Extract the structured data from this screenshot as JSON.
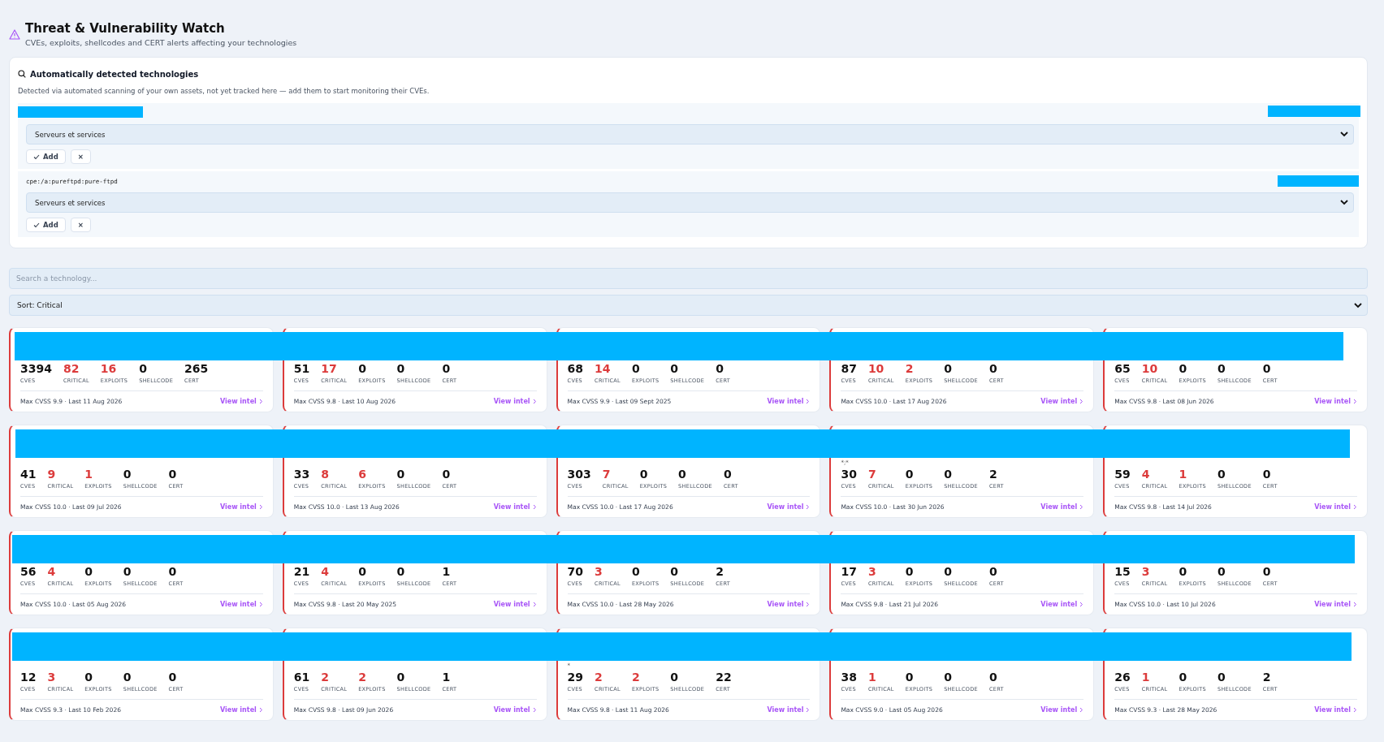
{
  "header": {
    "title": "Threat & Vulnerability Watch",
    "subtitle": "CVEs, exploits, shellcodes and CERT alerts affecting your technologies"
  },
  "detected": {
    "title": "Automatically detected technologies",
    "description": "Detected via automated scanning of your own assets, not yet tracked here — add them to start monitoring their CVEs.",
    "items": [
      {
        "category": "Serveurs et services",
        "add": "Add",
        "dismiss": "×"
      },
      {
        "cpe": "cpe:/a:pureftpd:pure-ftpd",
        "category": "Serveurs et services",
        "add": "Add",
        "dismiss": "×"
      }
    ]
  },
  "search": {
    "placeholder": "Search a technology..."
  },
  "sort": {
    "value": "Sort: Critical"
  },
  "cards": [
    {
      "stats": [
        {
          "value": "3394",
          "label": "CVES",
          "highlight": false
        },
        {
          "value": "82",
          "label": "CRITICAL",
          "highlight": true
        },
        {
          "value": "16",
          "label": "EXPLOITS",
          "highlight": true
        },
        {
          "value": "0",
          "label": "SHELLCODE",
          "highlight": false
        },
        {
          "value": "265",
          "label": "CERT",
          "highlight": false
        }
      ],
      "footer": "Max CVSS 9.9 · Last 11 Aug 2026",
      "link": "View intel"
    },
    {
      "stats": [
        {
          "value": "51",
          "label": "CVES",
          "highlight": false
        },
        {
          "value": "17",
          "label": "CRITICAL",
          "highlight": true
        },
        {
          "value": "0",
          "label": "EXPLOITS",
          "highlight": false
        },
        {
          "value": "0",
          "label": "SHELLCODE",
          "highlight": false
        },
        {
          "value": "0",
          "label": "CERT",
          "highlight": false
        }
      ],
      "footer": "Max CVSS 9.8 · Last 10 Aug 2026",
      "link": "View intel"
    },
    {
      "stats": [
        {
          "value": "68",
          "label": "CVES",
          "highlight": false
        },
        {
          "value": "14",
          "label": "CRITICAL",
          "highlight": true
        },
        {
          "value": "0",
          "label": "EXPLOITS",
          "highlight": false
        },
        {
          "value": "0",
          "label": "SHELLCODE",
          "highlight": false
        },
        {
          "value": "0",
          "label": "CERT",
          "highlight": false
        }
      ],
      "footer": "Max CVSS 9.9 · Last 09 Sept 2025",
      "link": "View intel"
    },
    {
      "stats": [
        {
          "value": "87",
          "label": "CVES",
          "highlight": false
        },
        {
          "value": "10",
          "label": "CRITICAL",
          "highlight": true
        },
        {
          "value": "2",
          "label": "EXPLOITS",
          "highlight": true
        },
        {
          "value": "0",
          "label": "SHELLCODE",
          "highlight": false
        },
        {
          "value": "0",
          "label": "CERT",
          "highlight": false
        }
      ],
      "footer": "Max CVSS 10.0 · Last 17 Aug 2026",
      "link": "View intel"
    },
    {
      "stats": [
        {
          "value": "65",
          "label": "CVES",
          "highlight": false
        },
        {
          "value": "10",
          "label": "CRITICAL",
          "highlight": true
        },
        {
          "value": "0",
          "label": "EXPLOITS",
          "highlight": false
        },
        {
          "value": "0",
          "label": "SHELLCODE",
          "highlight": false
        },
        {
          "value": "0",
          "label": "CERT",
          "highlight": false
        }
      ],
      "footer": "Max CVSS 9.8 · Last 08 Jun 2026",
      "link": "View intel"
    },
    {
      "stats": [
        {
          "value": "41",
          "label": "CVES",
          "highlight": false
        },
        {
          "value": "9",
          "label": "CRITICAL",
          "highlight": true
        },
        {
          "value": "1",
          "label": "EXPLOITS",
          "highlight": true
        },
        {
          "value": "0",
          "label": "SHELLCODE",
          "highlight": false
        },
        {
          "value": "0",
          "label": "CERT",
          "highlight": false
        }
      ],
      "footer": "Max CVSS 10.0 · Last 09 Jul 2026",
      "link": "View intel"
    },
    {
      "stats": [
        {
          "value": "33",
          "label": "CVES",
          "highlight": false
        },
        {
          "value": "8",
          "label": "CRITICAL",
          "highlight": true
        },
        {
          "value": "6",
          "label": "EXPLOITS",
          "highlight": true
        },
        {
          "value": "0",
          "label": "SHELLCODE",
          "highlight": false
        },
        {
          "value": "0",
          "label": "CERT",
          "highlight": false
        }
      ],
      "footer": "Max CVSS 10.0 · Last 13 Aug 2026",
      "link": "View intel"
    },
    {
      "stats": [
        {
          "value": "303",
          "label": "CVES",
          "highlight": false
        },
        {
          "value": "7",
          "label": "CRITICAL",
          "highlight": true
        },
        {
          "value": "0",
          "label": "EXPLOITS",
          "highlight": false
        },
        {
          "value": "0",
          "label": "SHELLCODE",
          "highlight": false
        },
        {
          "value": "0",
          "label": "CERT",
          "highlight": false
        }
      ],
      "footer": "Max CVSS 10.0 · Last 17 Aug 2026",
      "link": "View intel"
    },
    {
      "note": "*;*",
      "stats": [
        {
          "value": "30",
          "label": "CVES",
          "highlight": false
        },
        {
          "value": "7",
          "label": "CRITICAL",
          "highlight": true
        },
        {
          "value": "0",
          "label": "EXPLOITS",
          "highlight": false
        },
        {
          "value": "0",
          "label": "SHELLCODE",
          "highlight": false
        },
        {
          "value": "2",
          "label": "CERT",
          "highlight": false
        }
      ],
      "footer": "Max CVSS 10.0 · Last 30 Jun 2026",
      "link": "View intel"
    },
    {
      "stats": [
        {
          "value": "59",
          "label": "CVES",
          "highlight": false
        },
        {
          "value": "4",
          "label": "CRITICAL",
          "highlight": true
        },
        {
          "value": "1",
          "label": "EXPLOITS",
          "highlight": true
        },
        {
          "value": "0",
          "label": "SHELLCODE",
          "highlight": false
        },
        {
          "value": "0",
          "label": "CERT",
          "highlight": false
        }
      ],
      "footer": "Max CVSS 9.8 · Last 14 Jul 2026",
      "link": "View intel"
    },
    {
      "stats": [
        {
          "value": "56",
          "label": "CVES",
          "highlight": false
        },
        {
          "value": "4",
          "label": "CRITICAL",
          "highlight": true
        },
        {
          "value": "0",
          "label": "EXPLOITS",
          "highlight": false
        },
        {
          "value": "0",
          "label": "SHELLCODE",
          "highlight": false
        },
        {
          "value": "0",
          "label": "CERT",
          "highlight": false
        }
      ],
      "footer": "Max CVSS 10.0 · Last 05 Aug 2026",
      "link": "View intel"
    },
    {
      "stats": [
        {
          "value": "21",
          "label": "CVES",
          "highlight": false
        },
        {
          "value": "4",
          "label": "CRITICAL",
          "highlight": true
        },
        {
          "value": "0",
          "label": "EXPLOITS",
          "highlight": false
        },
        {
          "value": "0",
          "label": "SHELLCODE",
          "highlight": false
        },
        {
          "value": "1",
          "label": "CERT",
          "highlight": false
        }
      ],
      "footer": "Max CVSS 9.8 · Last 20 May 2025",
      "link": "View intel"
    },
    {
      "stats": [
        {
          "value": "70",
          "label": "CVES",
          "highlight": false
        },
        {
          "value": "3",
          "label": "CRITICAL",
          "highlight": true
        },
        {
          "value": "0",
          "label": "EXPLOITS",
          "highlight": false
        },
        {
          "value": "0",
          "label": "SHELLCODE",
          "highlight": false
        },
        {
          "value": "2",
          "label": "CERT",
          "highlight": false
        }
      ],
      "footer": "Max CVSS 10.0 · Last 28 May 2026",
      "link": "View intel"
    },
    {
      "stats": [
        {
          "value": "17",
          "label": "CVES",
          "highlight": false
        },
        {
          "value": "3",
          "label": "CRITICAL",
          "highlight": true
        },
        {
          "value": "0",
          "label": "EXPLOITS",
          "highlight": false
        },
        {
          "value": "0",
          "label": "SHELLCODE",
          "highlight": false
        },
        {
          "value": "0",
          "label": "CERT",
          "highlight": false
        }
      ],
      "footer": "Max CVSS 9.8 · Last 21 Jul 2026",
      "link": "View intel"
    },
    {
      "stats": [
        {
          "value": "15",
          "label": "CVES",
          "highlight": false
        },
        {
          "value": "3",
          "label": "CRITICAL",
          "highlight": true
        },
        {
          "value": "0",
          "label": "EXPLOITS",
          "highlight": false
        },
        {
          "value": "0",
          "label": "SHELLCODE",
          "highlight": false
        },
        {
          "value": "0",
          "label": "CERT",
          "highlight": false
        }
      ],
      "footer": "Max CVSS 10.0 · Last 10 Jul 2026",
      "link": "View intel"
    },
    {
      "stats": [
        {
          "value": "12",
          "label": "CVES",
          "highlight": false
        },
        {
          "value": "3",
          "label": "CRITICAL",
          "highlight": true
        },
        {
          "value": "0",
          "label": "EXPLOITS",
          "highlight": false
        },
        {
          "value": "0",
          "label": "SHELLCODE",
          "highlight": false
        },
        {
          "value": "0",
          "label": "CERT",
          "highlight": false
        }
      ],
      "footer": "Max CVSS 9.3 · Last 10 Feb 2026",
      "link": "View intel"
    },
    {
      "stats": [
        {
          "value": "61",
          "label": "CVES",
          "highlight": false
        },
        {
          "value": "2",
          "label": "CRITICAL",
          "highlight": true
        },
        {
          "value": "2",
          "label": "EXPLOITS",
          "highlight": true
        },
        {
          "value": "0",
          "label": "SHELLCODE",
          "highlight": false
        },
        {
          "value": "1",
          "label": "CERT",
          "highlight": false
        }
      ],
      "footer": "Max CVSS 9.8 · Last 09 Jun 2026",
      "link": "View intel"
    },
    {
      "note": "*",
      "stats": [
        {
          "value": "29",
          "label": "CVES",
          "highlight": false
        },
        {
          "value": "2",
          "label": "CRITICAL",
          "highlight": true
        },
        {
          "value": "2",
          "label": "EXPLOITS",
          "highlight": true
        },
        {
          "value": "0",
          "label": "SHELLCODE",
          "highlight": false
        },
        {
          "value": "22",
          "label": "CERT",
          "highlight": false
        }
      ],
      "footer": "Max CVSS 9.8 · Last 11 Aug 2026",
      "link": "View intel"
    },
    {
      "stats": [
        {
          "value": "38",
          "label": "CVES",
          "highlight": false
        },
        {
          "value": "1",
          "label": "CRITICAL",
          "highlight": true
        },
        {
          "value": "0",
          "label": "EXPLOITS",
          "highlight": false
        },
        {
          "value": "0",
          "label": "SHELLCODE",
          "highlight": false
        },
        {
          "value": "0",
          "label": "CERT",
          "highlight": false
        }
      ],
      "footer": "Max CVSS 9.0 · Last 05 Aug 2026",
      "link": "View intel"
    },
    {
      "stats": [
        {
          "value": "26",
          "label": "CVES",
          "highlight": false
        },
        {
          "value": "1",
          "label": "CRITICAL",
          "highlight": true
        },
        {
          "value": "0",
          "label": "EXPLOITS",
          "highlight": false
        },
        {
          "value": "0",
          "label": "SHELLCODE",
          "highlight": false
        },
        {
          "value": "2",
          "label": "CERT",
          "highlight": false
        }
      ],
      "footer": "Max CVSS 9.3 · Last 28 May 2026",
      "link": "View intel"
    }
  ]
}
